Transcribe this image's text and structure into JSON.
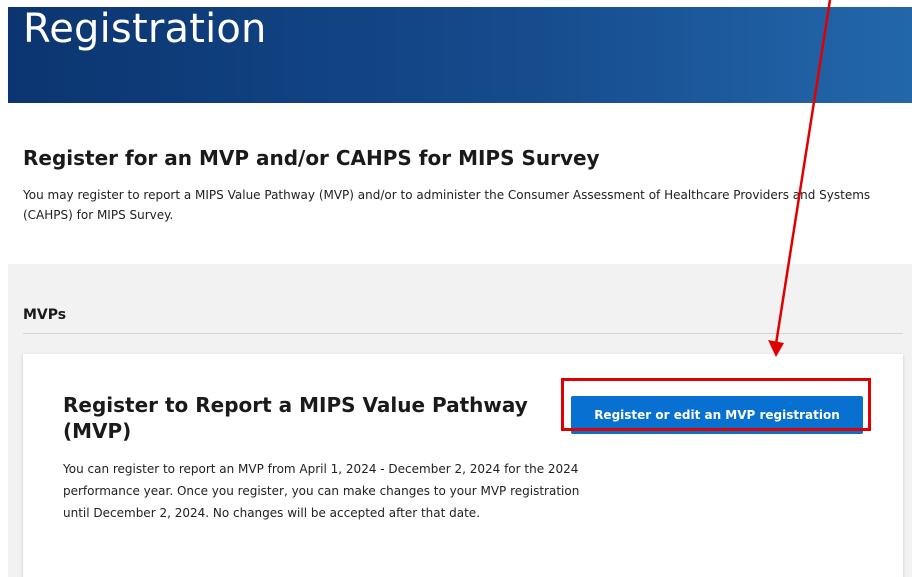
{
  "header": {
    "title": "Registration"
  },
  "intro": {
    "title": "Register for an MVP and/or CAHPS for MIPS Survey",
    "description": "You may register to report a MIPS Value Pathway (MVP) and/or to administer the Consumer Assessment of Healthcare Providers and Systems (CAHPS) for MIPS Survey."
  },
  "mvps": {
    "heading": "MVPs",
    "card": {
      "title": "Register to Report a MIPS Value Pathway (MVP)",
      "description": "You can register to report an MVP from April 1, 2024 - December 2, 2024 for the 2024 performance year. Once you register, you can make changes to your MVP registration until December 2, 2024. No changes will be accepted after that date.",
      "button_label": "Register or edit an MVP registration"
    }
  },
  "colors": {
    "header_start": "#0b3570",
    "header_end": "#2367ab",
    "button": "#0770d0",
    "annotation": "#e00000"
  }
}
